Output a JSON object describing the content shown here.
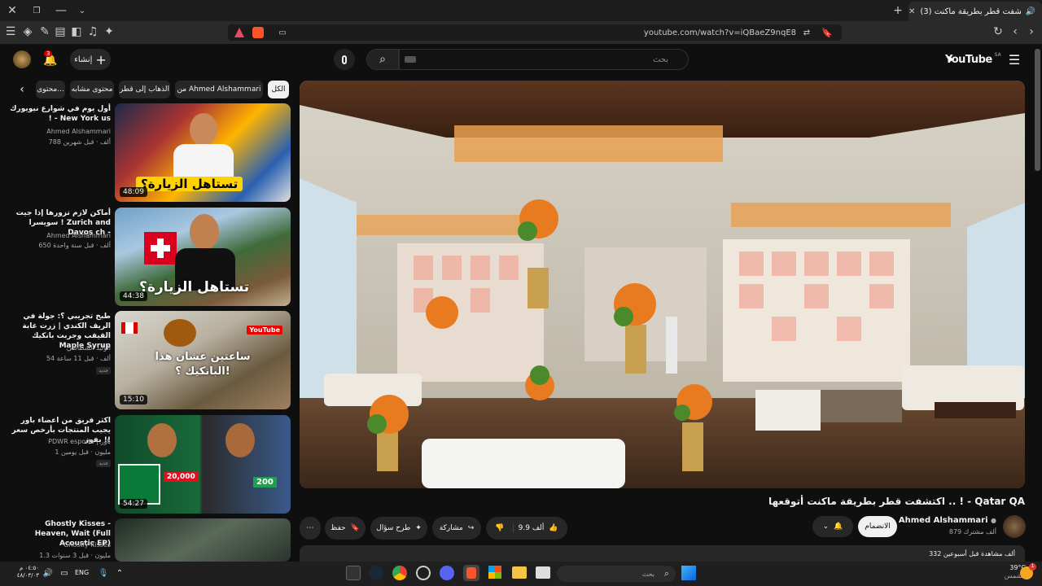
{
  "browser": {
    "tab_title": "(3) اكتشفت قطر بطريقة ماكنت",
    "url": "youtube.com/watch?v=iQBaeZ9nqE8"
  },
  "header": {
    "logo": "YouTube",
    "region": "SA",
    "search_placeholder": "بحث",
    "create_label": "إنشاء",
    "notif_count": "3"
  },
  "chips": [
    "الكل",
    "من Ahmed Alshammari",
    "الذهاب إلى قطر",
    "محتوى مشابه",
    "محتوى..."
  ],
  "related": [
    {
      "title": "أول يوم في شوارع نيويورك ! - New York us",
      "channel": "Ahmed Alshammari",
      "meta": "788 ألف · قبل شهرين",
      "duration": "48:09",
      "caption": "تستاهل الزيارة؟",
      "badge": ""
    },
    {
      "title": "أماكن لازم تزورها إذا جيت سويسرا ! Zurich and Davos ch -",
      "channel": "Ahmed Alshammari",
      "meta": "650 ألف · قبل سنة واحدة",
      "duration": "44:38",
      "caption": "تستاهل الزيارة؟",
      "badge": ""
    },
    {
      "title": "طبخ تجريبي ؟: جولة في الريف الكندي | زرت غابة القيقب وجربت بانكيك Maple Syrup",
      "channel": "الوليد الشطاطي",
      "meta": "54 ألف · قبل 11 ساعة",
      "duration": "15:10",
      "caption": "ساعتين عشان هذا البانكيك ؟!",
      "badge": "جديد"
    },
    {
      "title": "اكثر فريق من اعضاء باور يجيب المنتجات بأرخص سعر يفوز !!",
      "channel": "PDWR esports | باور",
      "meta": "1 مليون · قبل يومين",
      "duration": "54:27",
      "caption": "",
      "badge": "جديد"
    },
    {
      "title": "Ghostly Kisses - Heaven, Wait (Full Acoustic EP)",
      "channel": "Ghostly Kisses",
      "meta": "1.3 مليون · قبل 3 سنوات",
      "duration": "",
      "caption": "",
      "badge": ""
    }
  ],
  "video": {
    "title": "اكتشفت قطر بطريقة ماكنت أتوقعها .. ! - Qatar QA",
    "channel": "Ahmed Alshammari",
    "subscribers": "879 ألف مشترك",
    "join_label": "الانضمام",
    "likes": "9.9 ألف",
    "share_label": "مشاركة",
    "ask_label": "طرح سؤال",
    "save_label": "حفظ",
    "views": "332 ألف مشاهدة  قبل أسبوعين"
  },
  "taskbar": {
    "search_placeholder": "بحث",
    "lang": "ENG",
    "time": "٠٤:٥٠ م",
    "date": "٤٨/٠٣/٠٣",
    "weather_temp": "39°C",
    "weather_desc": "مشمس"
  },
  "colors": {
    "brand": "#ff0000",
    "accent": "#3ea6ff"
  }
}
